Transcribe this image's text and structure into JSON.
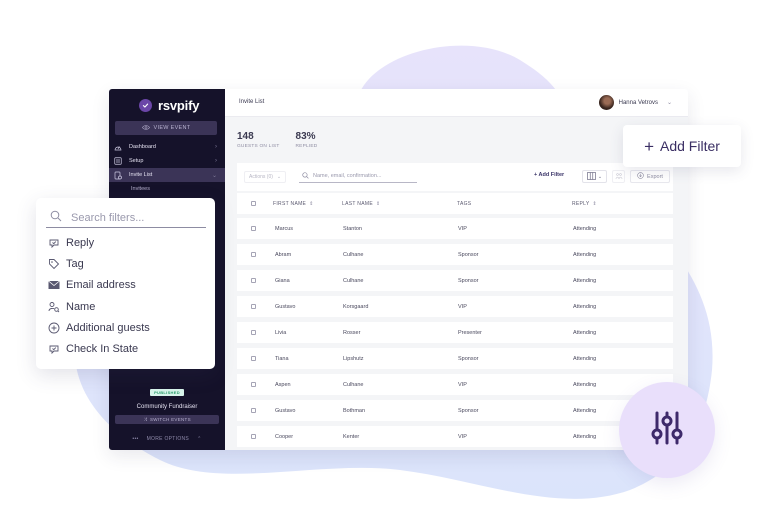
{
  "app": {
    "brand": "rsvpify",
    "colors": {
      "sidebar": "#15122a",
      "accent": "#3a2e63",
      "brand_purple": "#6b46a8",
      "published_badge": "#2c9c6c",
      "fab_bg": "#e9dffb"
    }
  },
  "sidebar": {
    "view_event_label": "VIEW EVENT",
    "items": [
      {
        "label": "Dashboard",
        "icon": "gauge-icon",
        "active": false
      },
      {
        "label": "Setup",
        "icon": "setup-icon",
        "active": false
      },
      {
        "label": "Invite List",
        "icon": "invite-list-icon",
        "active": true
      }
    ],
    "sub_items": [
      {
        "label": "Invitees"
      }
    ],
    "status_badge": "PUBLISHED",
    "event_name": "Community Fundraiser",
    "switch_events_label": "SWITCH EVENTS",
    "more_options_label": "MORE OPTIONS"
  },
  "header": {
    "breadcrumb": "Invite List",
    "user_name": "Hanna Vetrovs"
  },
  "stats": [
    {
      "value": "148",
      "label": "GUESTS ON LIST"
    },
    {
      "value": "83%",
      "label": "REPLIED"
    }
  ],
  "toolbar": {
    "actions_label": "Actions (0)",
    "search_placeholder": "Name, email, confirmation...",
    "add_filter_label": "+ Add Filter",
    "export_label": "Export"
  },
  "table": {
    "columns": [
      "FIRST NAME",
      "LAST NAME",
      "TAGS",
      "REPLY"
    ],
    "rows": [
      {
        "first": "Marcus",
        "last": "Stanton",
        "tag": "VIP",
        "reply": "Attending"
      },
      {
        "first": "Abram",
        "last": "Culhane",
        "tag": "Sponsor",
        "reply": "Attending"
      },
      {
        "first": "Giana",
        "last": "Culhane",
        "tag": "Sponsor",
        "reply": "Attending"
      },
      {
        "first": "Gustavo",
        "last": "Korsgaard",
        "tag": "VIP",
        "reply": "Attending"
      },
      {
        "first": "Livia",
        "last": "Rosser",
        "tag": "Presenter",
        "reply": "Attending"
      },
      {
        "first": "Tiana",
        "last": "Lipshutz",
        "tag": "Sponsor",
        "reply": "Attending"
      },
      {
        "first": "Aspen",
        "last": "Culhane",
        "tag": "VIP",
        "reply": "Attending"
      },
      {
        "first": "Gustavo",
        "last": "Bothman",
        "tag": "Sponsor",
        "reply": "Attending"
      },
      {
        "first": "Cooper",
        "last": "Kenter",
        "tag": "VIP",
        "reply": "Attending"
      }
    ]
  },
  "add_filter_card": {
    "label": "Add Filter"
  },
  "filter_panel": {
    "search_placeholder": "Search filters...",
    "items": [
      {
        "label": "Reply",
        "icon": "reply-icon"
      },
      {
        "label": "Tag",
        "icon": "tag-icon"
      },
      {
        "label": "Email address",
        "icon": "envelope-icon"
      },
      {
        "label": "Name",
        "icon": "person-search-icon"
      },
      {
        "label": "Additional guests",
        "icon": "plus-circle-icon"
      },
      {
        "label": "Check In State",
        "icon": "check-in-icon"
      }
    ]
  },
  "fab": {
    "icon": "sliders-icon"
  }
}
